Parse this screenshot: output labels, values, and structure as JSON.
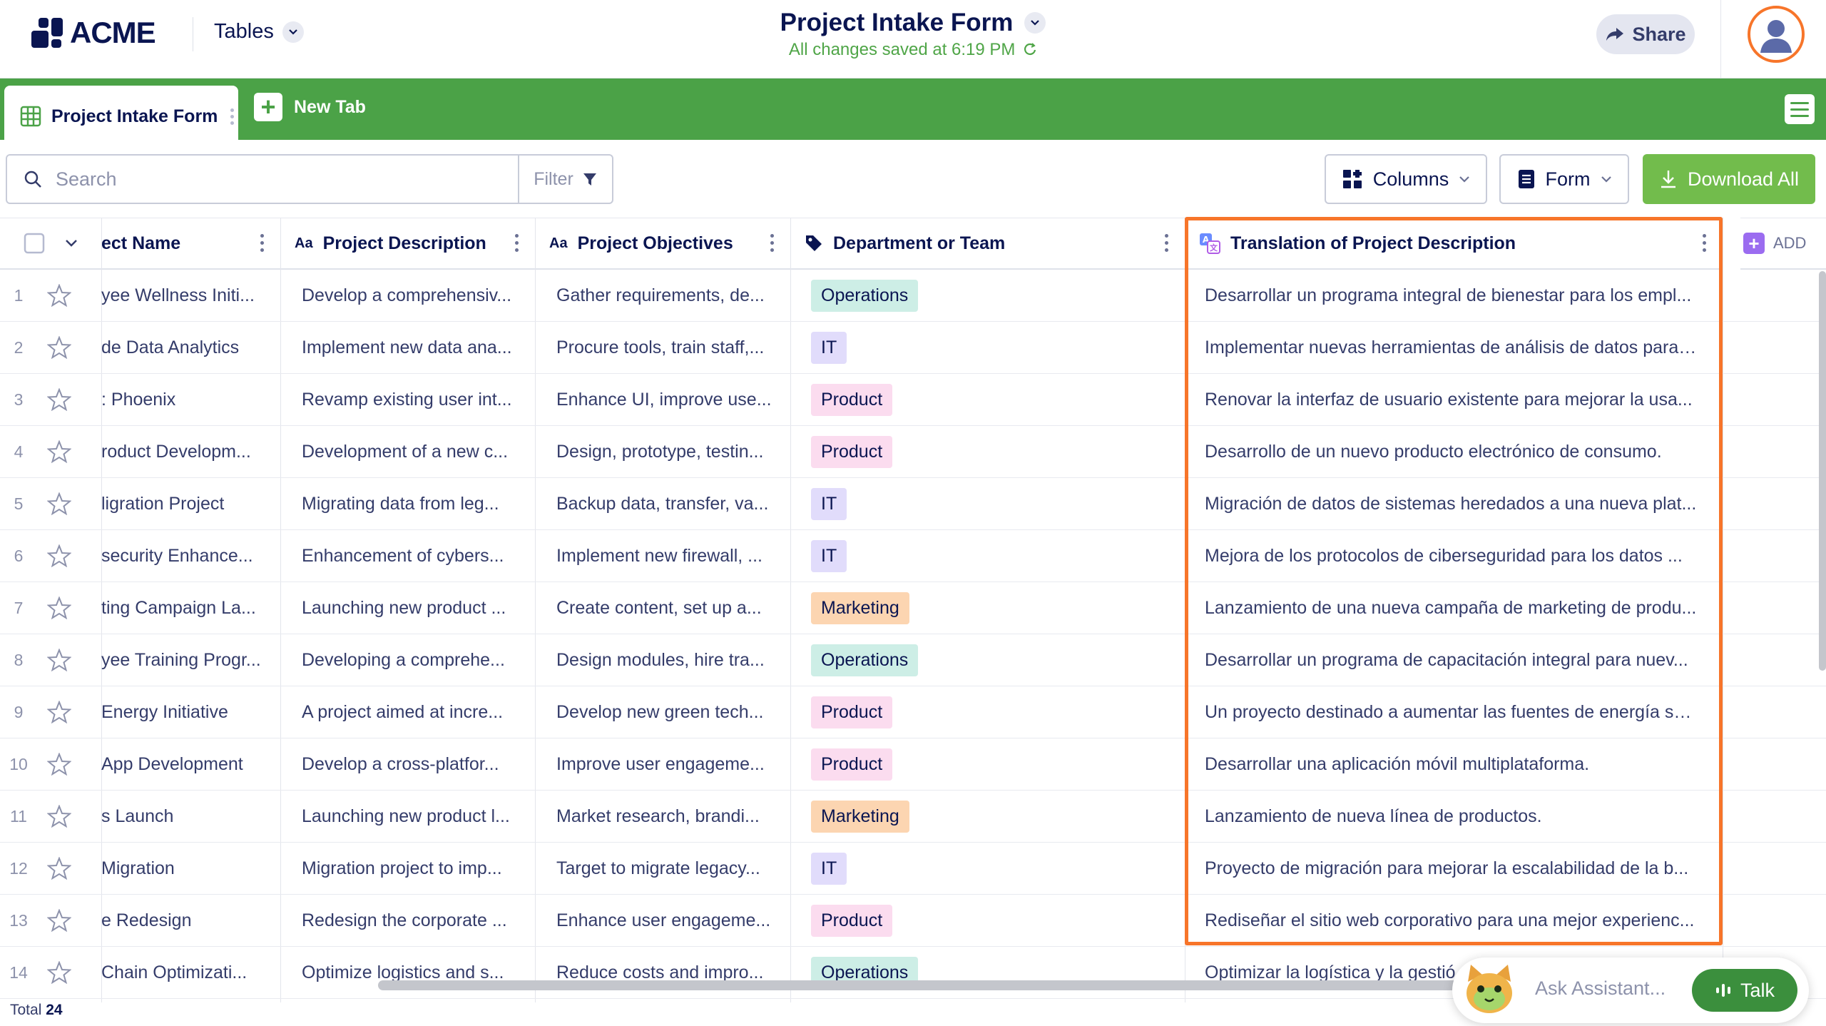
{
  "app": {
    "logo_text": "ACME",
    "tables_label": "Tables",
    "title": "Project Intake Form",
    "saved_status": "All changes saved at 6:19 PM",
    "share_label": "Share"
  },
  "tabs": {
    "active_label": "Project Intake Form",
    "new_tab_label": "New Tab"
  },
  "toolbar": {
    "search_placeholder": "Search",
    "filter_label": "Filter",
    "columns_label": "Columns",
    "form_label": "Form",
    "download_label": "Download All"
  },
  "table": {
    "headers": {
      "project_name": "ect Name",
      "project_description": "Project Description",
      "project_objectives": "Project Objectives",
      "department": "Department or Team",
      "translation": "Translation of Project Description",
      "add": "ADD",
      "text_type_marker": "Aa"
    },
    "rows": [
      {
        "num": "1",
        "name": "yee Wellness Initi...",
        "desc": "Develop a comprehensiv...",
        "obj": "Gather requirements, de...",
        "dept": "Operations",
        "trans": "Desarrollar un programa integral de bienestar para los empl..."
      },
      {
        "num": "2",
        "name": "de Data Analytics",
        "desc": "Implement new data ana...",
        "obj": "Procure tools, train staff,...",
        "dept": "IT",
        "trans": "Implementar nuevas herramientas de análisis de datos para ..."
      },
      {
        "num": "3",
        "name": ": Phoenix",
        "desc": "Revamp existing user int...",
        "obj": "Enhance UI, improve use...",
        "dept": "Product",
        "trans": "Renovar la interfaz de usuario existente para mejorar la usa..."
      },
      {
        "num": "4",
        "name": "roduct Developm...",
        "desc": "Development of a new c...",
        "obj": "Design, prototype, testin...",
        "dept": "Product",
        "trans": "Desarrollo de un nuevo producto electrónico de consumo."
      },
      {
        "num": "5",
        "name": "ligration Project",
        "desc": "Migrating data from leg...",
        "obj": "Backup data, transfer, va...",
        "dept": "IT",
        "trans": "Migración de datos de sistemas heredados a una nueva plat..."
      },
      {
        "num": "6",
        "name": "security Enhance...",
        "desc": "Enhancement of cybers...",
        "obj": "Implement new firewall, ...",
        "dept": "IT",
        "trans": "Mejora de los protocolos de ciberseguridad para los datos ..."
      },
      {
        "num": "7",
        "name": "ting Campaign La...",
        "desc": "Launching new product ...",
        "obj": "Create content, set up a...",
        "dept": "Marketing",
        "trans": "Lanzamiento de una nueva campaña de marketing de produ..."
      },
      {
        "num": "8",
        "name": "yee Training Progr...",
        "desc": "Developing a comprehe...",
        "obj": "Design modules, hire tra...",
        "dept": "Operations",
        "trans": "Desarrollar un programa de capacitación integral para nuev..."
      },
      {
        "num": "9",
        "name": "Energy Initiative",
        "desc": "A project aimed at incre...",
        "obj": "Develop new green tech...",
        "dept": "Product",
        "trans": "Un proyecto destinado a aumentar las fuentes de energía so..."
      },
      {
        "num": "10",
        "name": "App Development",
        "desc": "Develop a cross-platfor...",
        "obj": "Improve user engageme...",
        "dept": "Product",
        "trans": "Desarrollar una aplicación móvil multiplataforma."
      },
      {
        "num": "11",
        "name": "s Launch",
        "desc": "Launching new product l...",
        "obj": "Market research, brandi...",
        "dept": "Marketing",
        "trans": "Lanzamiento de nueva línea de productos."
      },
      {
        "num": "12",
        "name": "Migration",
        "desc": "Migration project to imp...",
        "obj": "Target to migrate legacy...",
        "dept": "IT",
        "trans": "Proyecto de migración para mejorar la escalabilidad de la b..."
      },
      {
        "num": "13",
        "name": "e Redesign",
        "desc": "Redesign the corporate ...",
        "obj": "Enhance user engageme...",
        "dept": "Product",
        "trans": "Rediseñar el sitio web corporativo para una mejor experienc..."
      },
      {
        "num": "14",
        "name": "Chain Optimizati...",
        "desc": "Optimize logistics and s...",
        "obj": "Reduce costs and impro...",
        "dept": "Operations",
        "trans": "Optimizar la logística y la gestió"
      }
    ]
  },
  "footer": {
    "total_label": "Total",
    "total_count": "24"
  },
  "assistant": {
    "placeholder": "Ask Assistant...",
    "talk_label": "Talk"
  },
  "colors": {
    "tabbar_green": "#4ba247",
    "download_green": "#72bc4c",
    "talk_green": "#3b8f3d",
    "highlight_orange": "#f7752a",
    "navy": "#0a1551",
    "badge_operations": "#cdeee6",
    "badge_it": "#e1dcfb",
    "badge_product": "#fbdcef",
    "badge_marketing": "#fcd5b1"
  },
  "icons": [
    "logo-mark",
    "chevron-down-icon",
    "refresh-icon",
    "share-arrow-icon",
    "user-avatar-icon",
    "grid-table-icon",
    "plus-icon",
    "hamburger-menu-icon",
    "search-icon",
    "filter-funnel-icon",
    "columns-icon",
    "form-doc-icon",
    "download-icon",
    "checkbox-icon",
    "star-icon",
    "tag-icon",
    "translate-icon",
    "kebab-icon",
    "assistant-avatar-icon",
    "voice-bars-icon"
  ]
}
